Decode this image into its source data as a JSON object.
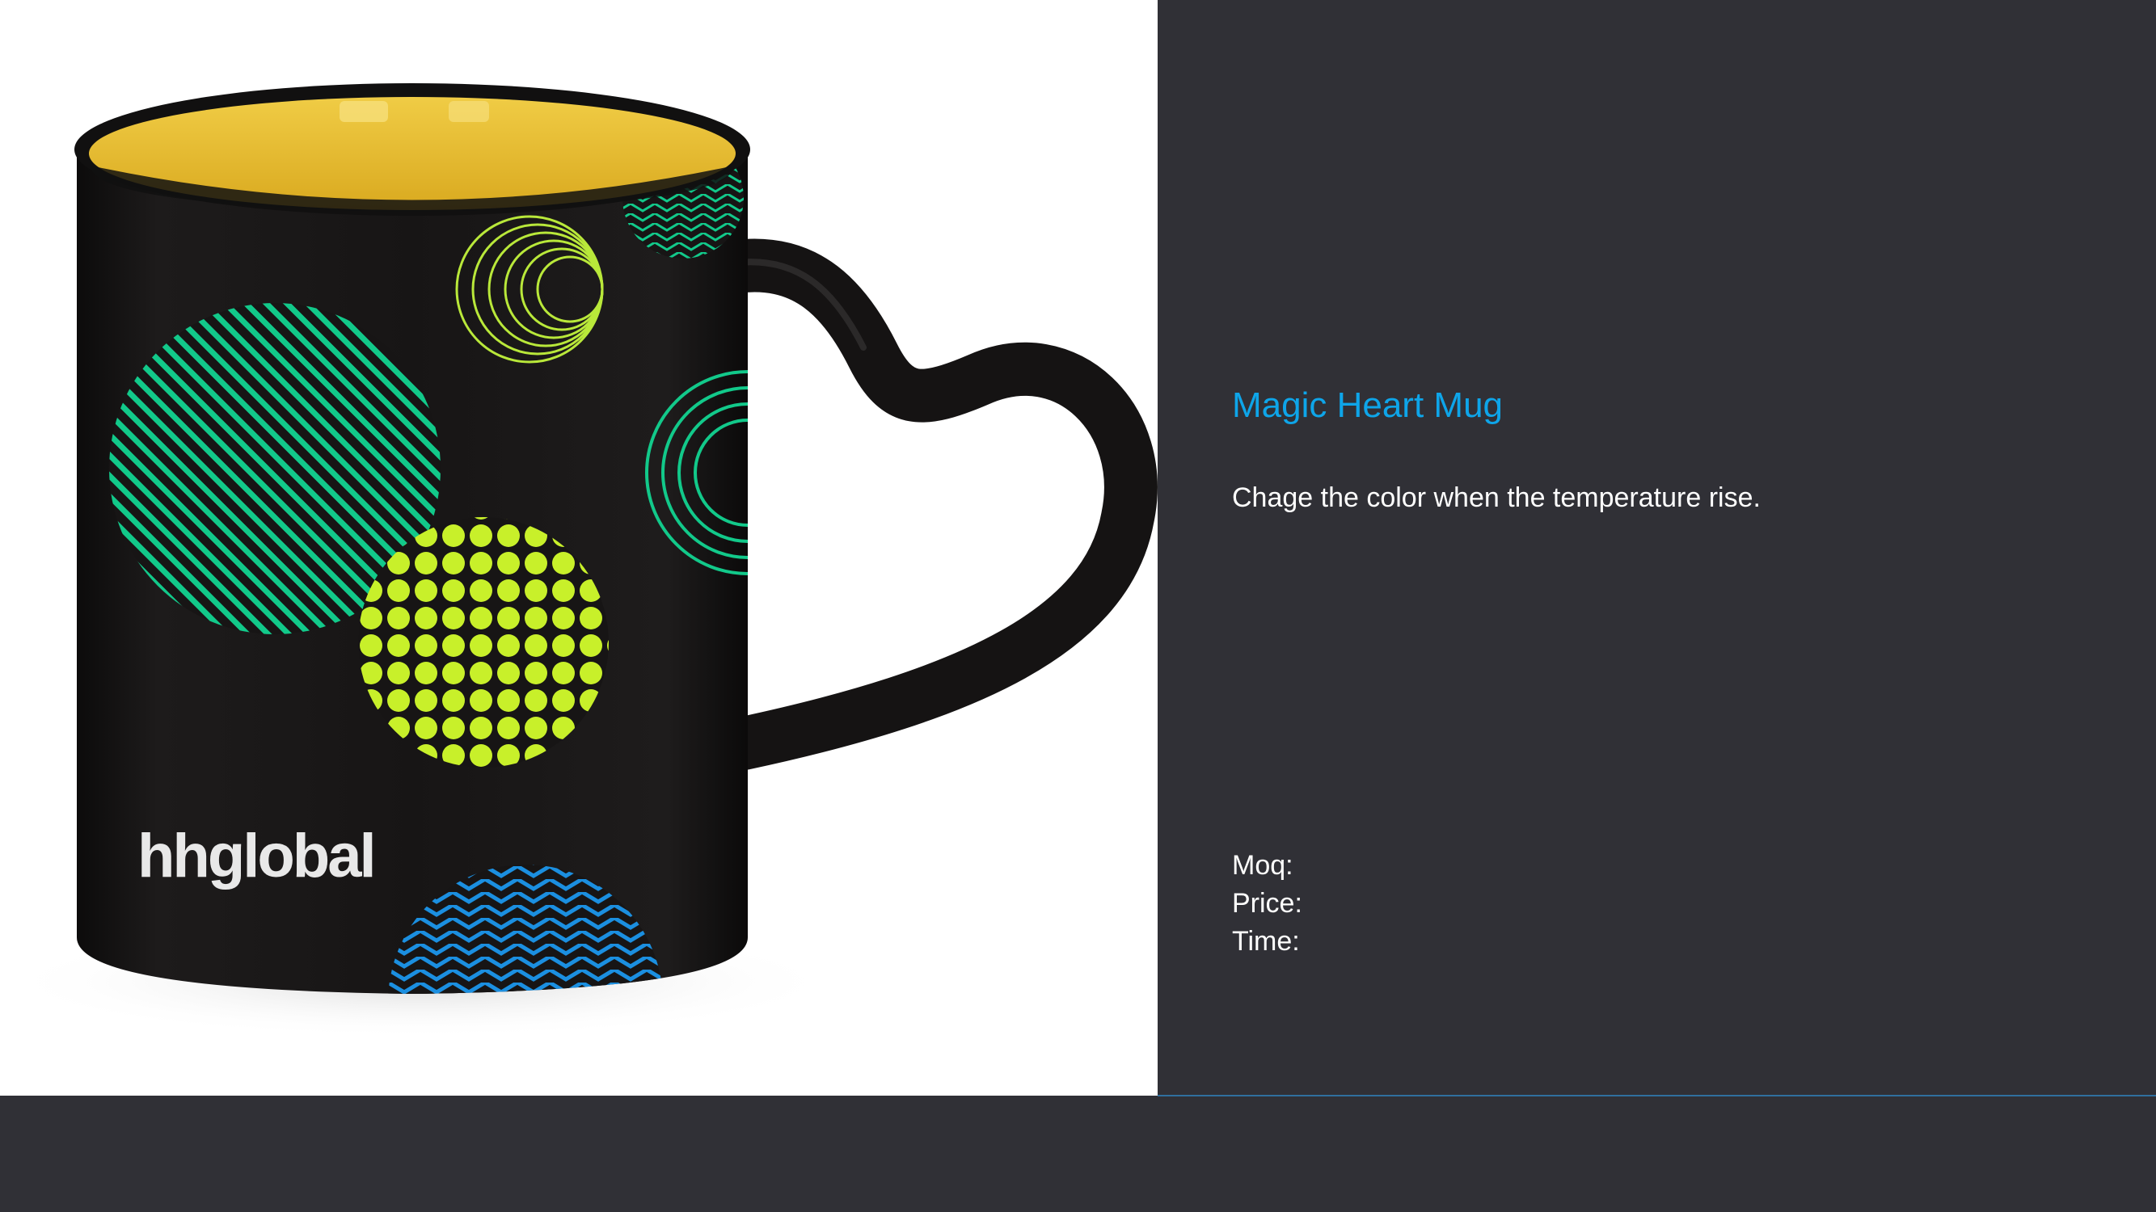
{
  "product": {
    "title": "Magic Heart Mug",
    "description": "Chage the color when the temperature rise.",
    "specs": [
      {
        "label": "Moq:"
      },
      {
        "label": "Price:"
      },
      {
        "label": "Time:"
      }
    ]
  },
  "image": {
    "logo_text": "hhglobal"
  },
  "colors": {
    "accent_blue": "#0ea5e9",
    "panel_background": "#303036",
    "text_white": "#ffffff",
    "mug_body": "#161414",
    "mug_interior": "#e2b629",
    "pattern_green": "#12c98a",
    "pattern_lime": "#c8f02a",
    "pattern_blue": "#1b8fe0"
  }
}
